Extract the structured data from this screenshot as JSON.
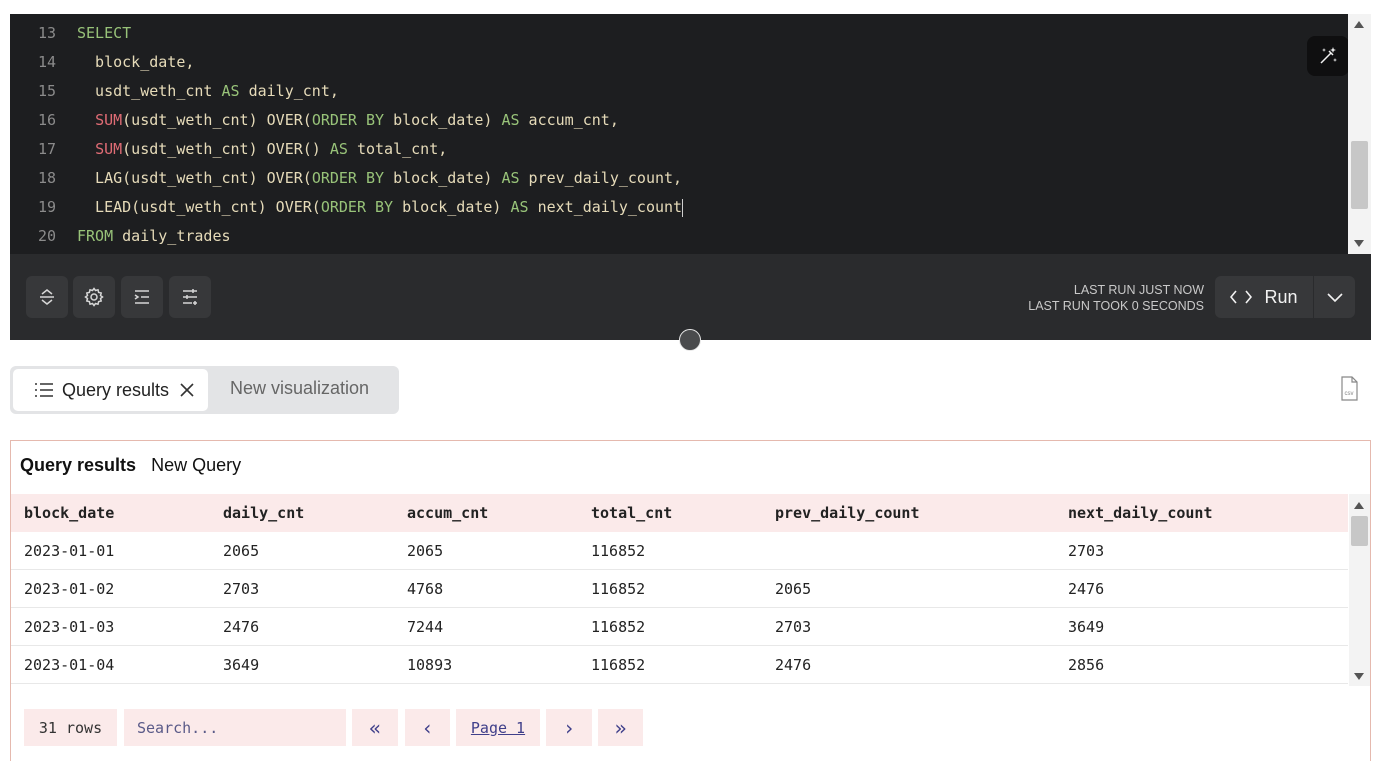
{
  "editor": {
    "lines": [
      {
        "num": "13",
        "tokens": [
          {
            "t": "SELECT",
            "c": "kw"
          }
        ]
      },
      {
        "num": "14",
        "tokens": [
          {
            "t": "  block_date,",
            "c": ""
          }
        ]
      },
      {
        "num": "15",
        "tokens": [
          {
            "t": "  usdt_weth_cnt ",
            "c": ""
          },
          {
            "t": "AS",
            "c": "kw"
          },
          {
            "t": " daily_cnt,",
            "c": ""
          }
        ]
      },
      {
        "num": "16",
        "tokens": [
          {
            "t": "  ",
            "c": ""
          },
          {
            "t": "SUM",
            "c": "fn"
          },
          {
            "t": "(usdt_weth_cnt) OVER(",
            "c": ""
          },
          {
            "t": "ORDER BY",
            "c": "kw"
          },
          {
            "t": " block_date) ",
            "c": ""
          },
          {
            "t": "AS",
            "c": "kw"
          },
          {
            "t": " accum_cnt,",
            "c": ""
          }
        ]
      },
      {
        "num": "17",
        "tokens": [
          {
            "t": "  ",
            "c": ""
          },
          {
            "t": "SUM",
            "c": "fn"
          },
          {
            "t": "(usdt_weth_cnt) OVER() ",
            "c": ""
          },
          {
            "t": "AS",
            "c": "kw"
          },
          {
            "t": " total_cnt,",
            "c": ""
          }
        ]
      },
      {
        "num": "18",
        "tokens": [
          {
            "t": "  LAG(usdt_weth_cnt) OVER(",
            "c": ""
          },
          {
            "t": "ORDER BY",
            "c": "kw"
          },
          {
            "t": " block_date) ",
            "c": ""
          },
          {
            "t": "AS",
            "c": "kw"
          },
          {
            "t": " prev_daily_count,",
            "c": ""
          }
        ]
      },
      {
        "num": "19",
        "tokens": [
          {
            "t": "  LEAD(usdt_weth_cnt) OVER(",
            "c": ""
          },
          {
            "t": "ORDER BY",
            "c": "kw"
          },
          {
            "t": " block_date) ",
            "c": ""
          },
          {
            "t": "AS",
            "c": "kw"
          },
          {
            "t": " next_daily_count",
            "c": ""
          }
        ],
        "caret": true
      },
      {
        "num": "20",
        "tokens": [
          {
            "t": "FROM",
            "c": "kw"
          },
          {
            "t": " daily_trades",
            "c": ""
          }
        ]
      }
    ]
  },
  "toolbar": {
    "icons": [
      "collapse-icon",
      "settings-icon",
      "format-icon",
      "params-icon"
    ],
    "last_run": "LAST RUN JUST NOW",
    "last_took": "LAST RUN TOOK 0 SECONDS",
    "run_label": "Run"
  },
  "tabs": {
    "active_label": "Query results",
    "new_label": "New visualization"
  },
  "results": {
    "title": "Query results",
    "subtitle": "New Query",
    "columns": [
      "block_date",
      "daily_cnt",
      "accum_cnt",
      "total_cnt",
      "prev_daily_count",
      "next_daily_count"
    ],
    "rows": [
      [
        "2023-01-01",
        "2065",
        "2065",
        "116852",
        "",
        "2703"
      ],
      [
        "2023-01-02",
        "2703",
        "4768",
        "116852",
        "2065",
        "2476"
      ],
      [
        "2023-01-03",
        "2476",
        "7244",
        "116852",
        "2703",
        "3649"
      ],
      [
        "2023-01-04",
        "3649",
        "10893",
        "116852",
        "2476",
        "2856"
      ]
    ],
    "row_count": "31 rows",
    "search_placeholder": "Search...",
    "page_label": "Page 1"
  },
  "colors": {
    "editor_bg": "#1d1e20",
    "keyword": "#98c379",
    "function": "#e06c75",
    "header_bg": "#fbeaea",
    "panel_border": "#e5b9ae"
  }
}
